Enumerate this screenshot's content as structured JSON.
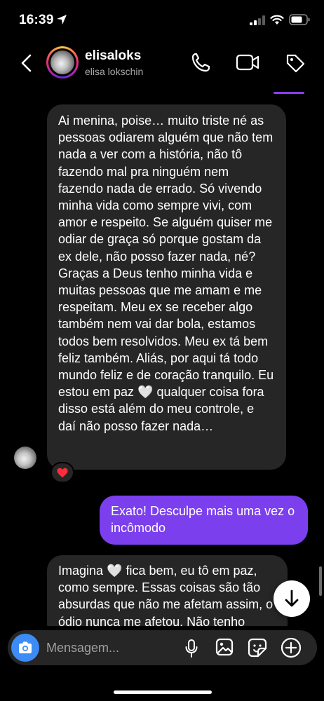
{
  "status_bar": {
    "time": "16:39"
  },
  "header": {
    "username": "elisaloks",
    "full_name": "elisa lokschin",
    "icons": [
      "back-icon",
      "phone-icon",
      "video-icon",
      "tag-icon"
    ]
  },
  "messages": [
    {
      "direction": "incoming",
      "text": "Ai menina, poise… muito triste né as pessoas odiarem alguém que não tem nada a ver com a história, não tô fazendo mal pra ninguém nem fazendo nada de errado. Só vivendo minha vida como sempre vivi, com amor e respeito. Se alguém quiser me odiar de graça só porque gostam da ex dele, não posso fazer nada, né? Graças a Deus tenho minha vida e muitas pessoas que me amam e me respeitam. Meu ex se receber algo também nem vai dar bola, estamos todos bem resolvidos. Meu ex tá bem feliz também. Aliás, por aqui tá todo mundo feliz e de coração tranquilo. Eu estou em paz 🤍 qualquer coisa fora disso está além do meu controle, e daí não posso fazer nada…",
      "reaction": "❤️"
    },
    {
      "direction": "outgoing",
      "text": "Exato! Desculpe mais uma vez o incômodo"
    },
    {
      "direction": "incoming",
      "text": "Imagina 🤍 fica bem, eu tô em paz, como sempre. Essas coisas são tão absurdas que não me afetam assim, o ódio nunca me afetou. Não tenho"
    }
  ],
  "composer": {
    "placeholder": "Mensagem...",
    "icons": [
      "camera-icon",
      "mic-icon",
      "gallery-icon",
      "sticker-icon",
      "add-icon"
    ]
  },
  "colors": {
    "background": "#000000",
    "incoming_bubble": "#262626",
    "outgoing_bubble": "#7b3fee",
    "camera_button": "#3d8bf5"
  }
}
